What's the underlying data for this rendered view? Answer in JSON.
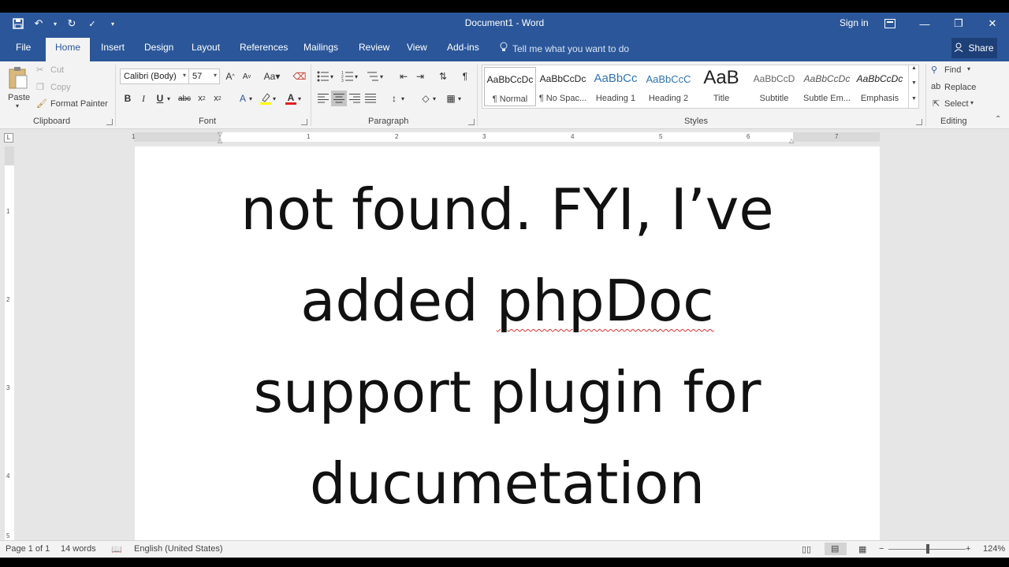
{
  "app": {
    "title": "Document1 - Word",
    "sign_in": "Sign in",
    "share": "Share"
  },
  "tabs": [
    "File",
    "Home",
    "Insert",
    "Design",
    "Layout",
    "References",
    "Mailings",
    "Review",
    "View",
    "Add-ins"
  ],
  "active_tab": "Home",
  "tell_me": "Tell me what you want to do",
  "clipboard": {
    "paste": "Paste",
    "cut": "Cut",
    "copy": "Copy",
    "format_painter": "Format Painter",
    "label": "Clipboard"
  },
  "font": {
    "name": "Calibri (Body)",
    "size": "57",
    "label": "Font"
  },
  "paragraph": {
    "label": "Paragraph"
  },
  "styles": {
    "label": "Styles",
    "items": [
      {
        "sample": "AaBbCcDc",
        "name": "¶ Normal"
      },
      {
        "sample": "AaBbCcDc",
        "name": "¶ No Spac..."
      },
      {
        "sample": "AaBbCc",
        "name": "Heading 1"
      },
      {
        "sample": "AaBbCcC",
        "name": "Heading 2"
      },
      {
        "sample": "AaB",
        "name": "Title"
      },
      {
        "sample": "AaBbCcD",
        "name": "Subtitle"
      },
      {
        "sample": "AaBbCcDc",
        "name": "Subtle Em..."
      },
      {
        "sample": "AaBbCcDc",
        "name": "Emphasis"
      }
    ]
  },
  "editing": {
    "find": "Find",
    "replace": "Replace",
    "select": "Select",
    "label": "Editing"
  },
  "ruler": {
    "h_labels": [
      "1",
      "1",
      "2",
      "3",
      "4",
      "5",
      "6",
      "7"
    ],
    "v_labels": [
      "1",
      "2",
      "3",
      "4",
      "5"
    ]
  },
  "document": {
    "lines": [
      "not found. FYI, I’ve",
      "added ",
      "phpDoc",
      "support plugin for",
      "ducumetation"
    ]
  },
  "status": {
    "page": "Page 1 of 1",
    "words": "14 words",
    "language": "English (United States)",
    "zoom": "124%"
  },
  "colors": {
    "accent": "#2b579a",
    "font_color": "#e0201a",
    "highlight": "#ffff00"
  }
}
